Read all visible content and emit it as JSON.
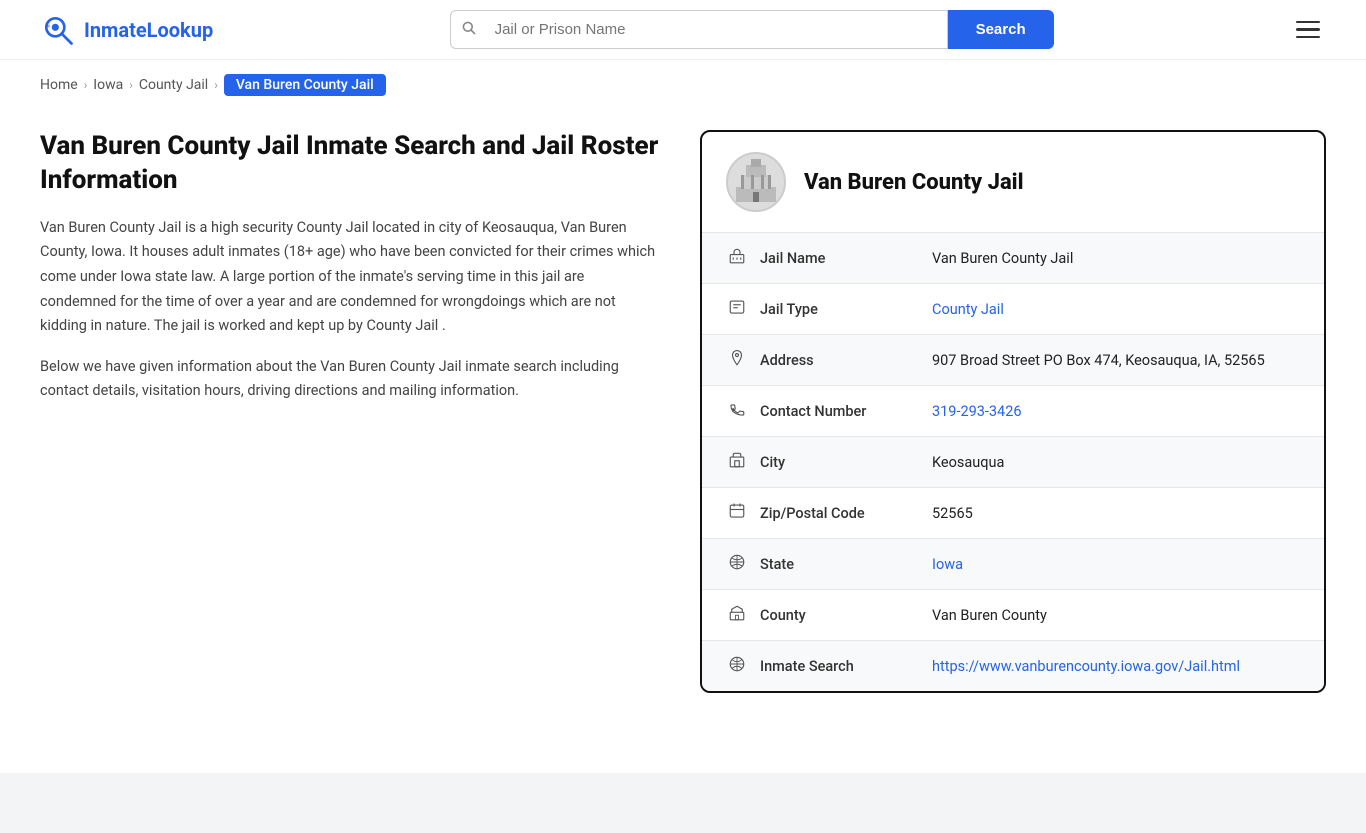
{
  "header": {
    "logo_text_normal": "Inmate",
    "logo_text_colored": "Lookup",
    "search_placeholder": "Jail or Prison Name",
    "search_button_label": "Search"
  },
  "breadcrumb": {
    "items": [
      {
        "label": "Home",
        "href": "#"
      },
      {
        "label": "Iowa",
        "href": "#"
      },
      {
        "label": "County Jail",
        "href": "#"
      },
      {
        "label": "Van Buren County Jail",
        "active": true
      }
    ]
  },
  "left": {
    "title": "Van Buren County Jail Inmate Search and Jail Roster Information",
    "description1": "Van Buren County Jail is a high security County Jail located in city of Keosauqua, Van Buren County, Iowa. It houses adult inmates (18+ age) who have been convicted for their crimes which come under Iowa state law. A large portion of the inmate's serving time in this jail are condemned for the time of over a year and are condemned for wrongdoings which are not kidding in nature. The jail is worked and kept up by County Jail .",
    "description2": "Below we have given information about the Van Buren County Jail inmate search including contact details, visitation hours, driving directions and mailing information."
  },
  "card": {
    "title": "Van Buren County Jail",
    "rows": [
      {
        "icon": "jail-icon",
        "label": "Jail Name",
        "value": "Van Buren County Jail",
        "link": null
      },
      {
        "icon": "type-icon",
        "label": "Jail Type",
        "value": "County Jail",
        "link": "#"
      },
      {
        "icon": "location-icon",
        "label": "Address",
        "value": "907 Broad Street PO Box 474, Keosauqua, IA, 52565",
        "link": null
      },
      {
        "icon": "phone-icon",
        "label": "Contact Number",
        "value": "319-293-3426",
        "link": "tel:319-293-3426"
      },
      {
        "icon": "city-icon",
        "label": "City",
        "value": "Keosauqua",
        "link": null
      },
      {
        "icon": "zip-icon",
        "label": "Zip/Postal Code",
        "value": "52565",
        "link": null
      },
      {
        "icon": "state-icon",
        "label": "State",
        "value": "Iowa",
        "link": "#"
      },
      {
        "icon": "county-icon",
        "label": "County",
        "value": "Van Buren County",
        "link": null
      },
      {
        "icon": "web-icon",
        "label": "Inmate Search",
        "value": "https://www.vanburencounty.iowa.gov/Jail.html",
        "link": "https://www.vanburencounty.iowa.gov/Jail.html"
      }
    ]
  }
}
